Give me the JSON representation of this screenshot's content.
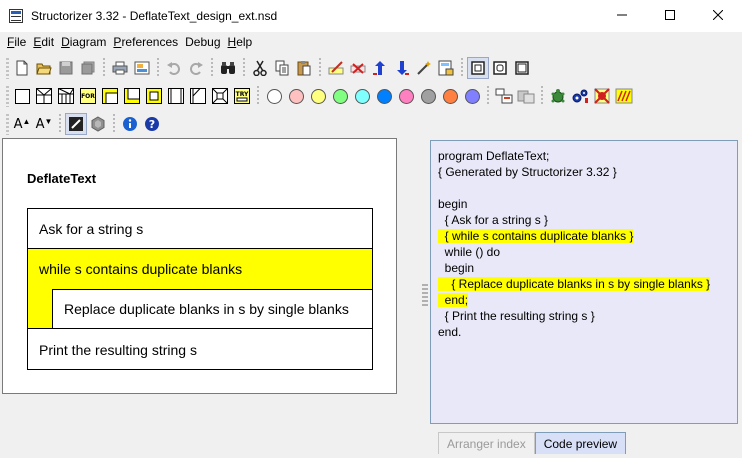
{
  "window": {
    "title": "Structorizer 3.32 - DeflateText_design_ext.nsd"
  },
  "menu": [
    {
      "key": "F",
      "rest": "ile"
    },
    {
      "key": "E",
      "rest": "dit"
    },
    {
      "key": "D",
      "rest": "iagram"
    },
    {
      "key": "P",
      "rest": "references"
    },
    {
      "key": "D",
      "pre": "De",
      "rest": "bug"
    },
    {
      "key": "H",
      "rest": "elp"
    }
  ],
  "colors": {
    "highlight": "#ffff00",
    "code_bg": "#e8e8f8",
    "palette": [
      "#ffffff",
      "#ffc0c0",
      "#ffff80",
      "#80ff80",
      "#80ffff",
      "#0080ff",
      "#ff80c0",
      "#a0a0a0",
      "#ff8040",
      "#8080ff"
    ]
  },
  "diagram": {
    "title": "DeflateText",
    "elements": {
      "input": "Ask for a string s",
      "loop": "while s contains duplicate blanks",
      "loop_body": "Replace duplicate blanks in s by single blanks",
      "output": "Print the resulting string s"
    }
  },
  "code": {
    "lines": [
      {
        "text": "program DeflateText;",
        "hl": false
      },
      {
        "text": "{ Generated by Structorizer 3.32 }",
        "hl": false
      },
      {
        "text": "",
        "hl": false
      },
      {
        "text": "begin",
        "hl": false
      },
      {
        "text": "  { Ask for a string s }",
        "hl": false
      },
      {
        "text": "  { while s contains duplicate blanks }",
        "hl": true
      },
      {
        "text": "  while () do",
        "hl": false
      },
      {
        "text": "  begin",
        "hl": false
      },
      {
        "text": "    { Replace duplicate blanks in s by single blanks }",
        "hl": true
      },
      {
        "text": "  end;",
        "hl": true
      },
      {
        "text": "  { Print the resulting string s }",
        "hl": false
      },
      {
        "text": "end.",
        "hl": false
      }
    ]
  },
  "tabs": {
    "arranger": "Arranger index",
    "preview": "Code preview"
  },
  "toolbar3": {
    "font_up": "A",
    "font_down": "A"
  }
}
